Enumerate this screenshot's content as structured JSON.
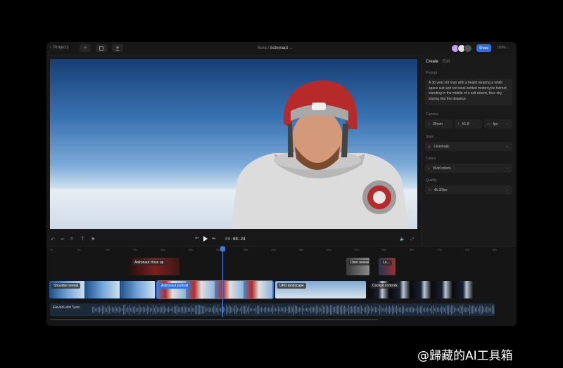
{
  "topbar": {
    "back_label": "Projects",
    "breadcrumb_app": "Sora",
    "breadcrumb_sep": "/",
    "breadcrumb_project": "Astronaut",
    "share_label": "Share",
    "zoom": "100%"
  },
  "panel": {
    "tabs": [
      "Create",
      "Edit"
    ],
    "prompt_label": "Prompt",
    "prompt_text": "A 30 year old man with a beard wearing a white space suit and red wool knitted motorcycle helmet, standing in the middle of a salt desert, blue sky, staring into the distance",
    "camera_label": "Camera",
    "camera": {
      "lens": "35mm",
      "aperture": "f/1.8",
      "fps": "fps"
    },
    "style_label": "Style",
    "style_value": "Cinematic",
    "colors_label": "Colors",
    "colors_value": "Vivid colors",
    "quality_label": "Quality",
    "quality_value": "4k 30fps"
  },
  "player": {
    "timecode_prefix": "00:",
    "timecode": "08:24"
  },
  "timeline": {
    "ticks": [
      "0s",
      "5s",
      "10s",
      "15s",
      "20s",
      "25s",
      "30s",
      "35s",
      "40s",
      "45s",
      "50s",
      "55s",
      "60s",
      "65s",
      "70s",
      "75s",
      "80s"
    ],
    "clips_top": [
      {
        "label": "Astronaut close up"
      },
      {
        "label": "Door reveal"
      },
      {
        "label": "Lo..."
      }
    ],
    "clips_main": [
      {
        "label": "Shoulder reveal"
      },
      {
        "label": "Astronaut portrait"
      },
      {
        "label": "UFO landscape"
      },
      {
        "label": "Cockpit controls"
      }
    ],
    "audio_label": "ElevenLabs Sync"
  },
  "watermark": "@歸藏的AI工具箱",
  "colors": {
    "accent": "#2f6fe0",
    "bg": "#181818",
    "helmet": "#b62a2a"
  }
}
